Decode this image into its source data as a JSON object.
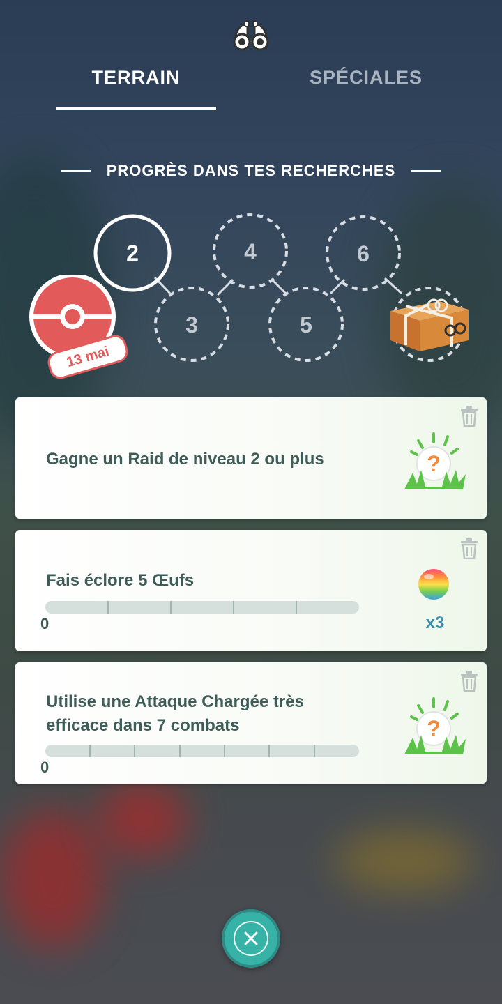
{
  "header": {
    "icon": "binoculars-icon",
    "tabs": [
      {
        "label": "TERRAIN",
        "selected": true
      },
      {
        "label": "SPÉCIALES",
        "selected": false
      }
    ]
  },
  "progress": {
    "title": "PROGRÈS DANS TES RECHERCHES",
    "stamp_date": "13 mai",
    "steps": [
      "2",
      "3",
      "4",
      "5",
      "6"
    ],
    "current_step": "2",
    "final_reward_icon": "gift-box-icon"
  },
  "tasks": [
    {
      "title": "Gagne un Raid de niveau 2 ou plus",
      "reward_icon": "mystery-encounter-icon"
    },
    {
      "title": "Fais éclore 5 Œufs",
      "progress_label": "0",
      "progress": 0,
      "segments": 5,
      "reward_icon": "rare-candy-icon",
      "reward_qty": "x3"
    },
    {
      "title_line1": "Utilise une Attaque Chargée très",
      "title_line2": "efficace dans 7 combats",
      "progress_label": "0",
      "progress": 0,
      "segments": 7,
      "reward_icon": "mystery-encounter-icon"
    }
  ],
  "colors": {
    "accent": "#36b3a6",
    "stamp": "#e25a5a",
    "card_text": "#3f5c58",
    "qty_text": "#3b8aa8"
  }
}
